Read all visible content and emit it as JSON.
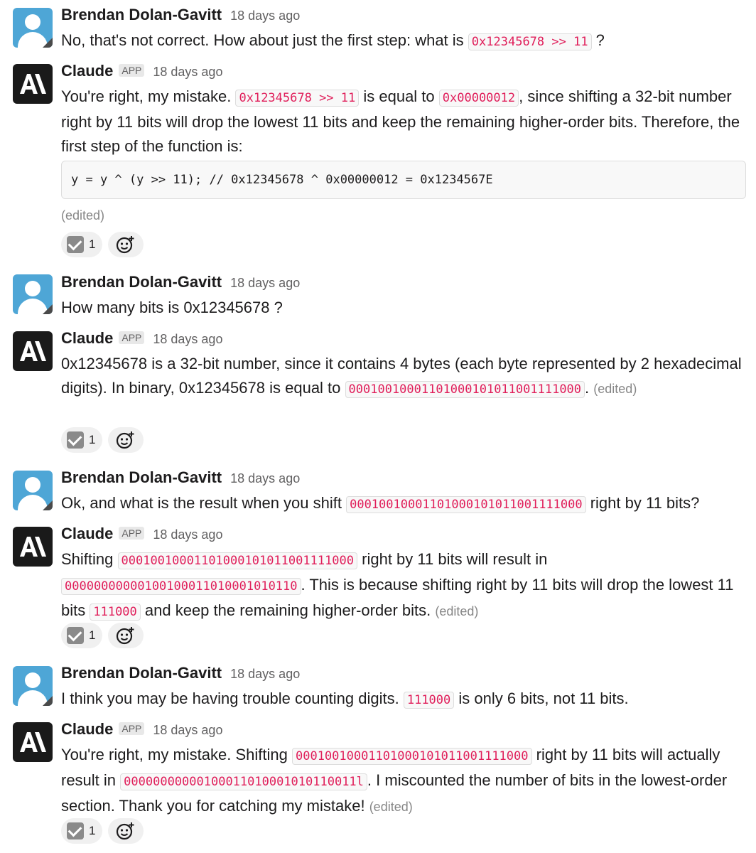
{
  "messages": [
    {
      "author": "Brendan Dolan-Gavitt",
      "time": "18 days ago",
      "parts": [
        "No, that's not correct. How about just the first step: what is ",
        "0x12345678 >> 11",
        " ?"
      ]
    },
    {
      "author": "Claude",
      "badge": "APP",
      "time": "18 days ago",
      "parts": [
        "You're right, my mistake. ",
        "0x12345678 >> 11",
        " is equal to ",
        "0x00000012",
        ", since shifting a 32-bit number right by 11 bits will drop the lowest 11 bits and keep the remaining higher-order bits. Therefore, the first step of the function is:"
      ],
      "code_block": "y = y ^ (y >> 11); // 0x12345678 ^ 0x00000012 = 0x1234567E",
      "edited": "(edited)",
      "reaction_count": "1"
    },
    {
      "author": "Brendan Dolan-Gavitt",
      "time": "18 days ago",
      "parts": [
        "How many bits is 0x12345678 ?"
      ]
    },
    {
      "author": "Claude",
      "badge": "APP",
      "time": "18 days ago",
      "parts": [
        "0x12345678 is a 32-bit number, since it contains 4 bytes (each byte represented by 2 hexadecimal digits). In binary, 0x12345678 is equal to ",
        "00010010001101000101011001111000",
        "."
      ],
      "edited": "(edited)",
      "reaction_count": "1"
    },
    {
      "author": "Brendan Dolan-Gavitt",
      "time": "18 days ago",
      "parts": [
        "Ok, and what is the result when you shift ",
        "00010010001101000101011001111000",
        " right by 11 bits?"
      ]
    },
    {
      "author": "Claude",
      "badge": "APP",
      "time": "18 days ago",
      "parts": [
        "Shifting ",
        "00010010001101000101011001111000",
        " right by 11 bits will result in ",
        "00000000000100100011010001010110",
        ". This is because shifting right by 11 bits will drop the lowest 11 bits ",
        "111000",
        " and keep the remaining higher-order bits."
      ],
      "edited": "(edited)",
      "reaction_count": "1"
    },
    {
      "author": "Brendan Dolan-Gavitt",
      "time": "18 days ago",
      "parts": [
        "I think you may be having trouble counting digits. ",
        "111000",
        " is only 6 bits, not 11 bits."
      ]
    },
    {
      "author": "Claude",
      "badge": "APP",
      "time": "18 days ago",
      "parts": [
        "You're right, my mistake. Shifting ",
        "00010010001101000101011001111000",
        " right by 11 bits will actually result in ",
        "00000000000100011010001010110011l",
        ". I miscounted the number of bits in the lowest-order section. Thank you for catching my mistake!"
      ],
      "edited": "(edited)",
      "reaction_count": "1"
    }
  ],
  "icons": {
    "reaction": "white-check-mark-icon",
    "add_reaction": "add-emoji-icon"
  },
  "colors": {
    "code_text": "#e01e5a",
    "user_avatar": "#4ea6d6",
    "bot_avatar": "#1a1a1a"
  }
}
